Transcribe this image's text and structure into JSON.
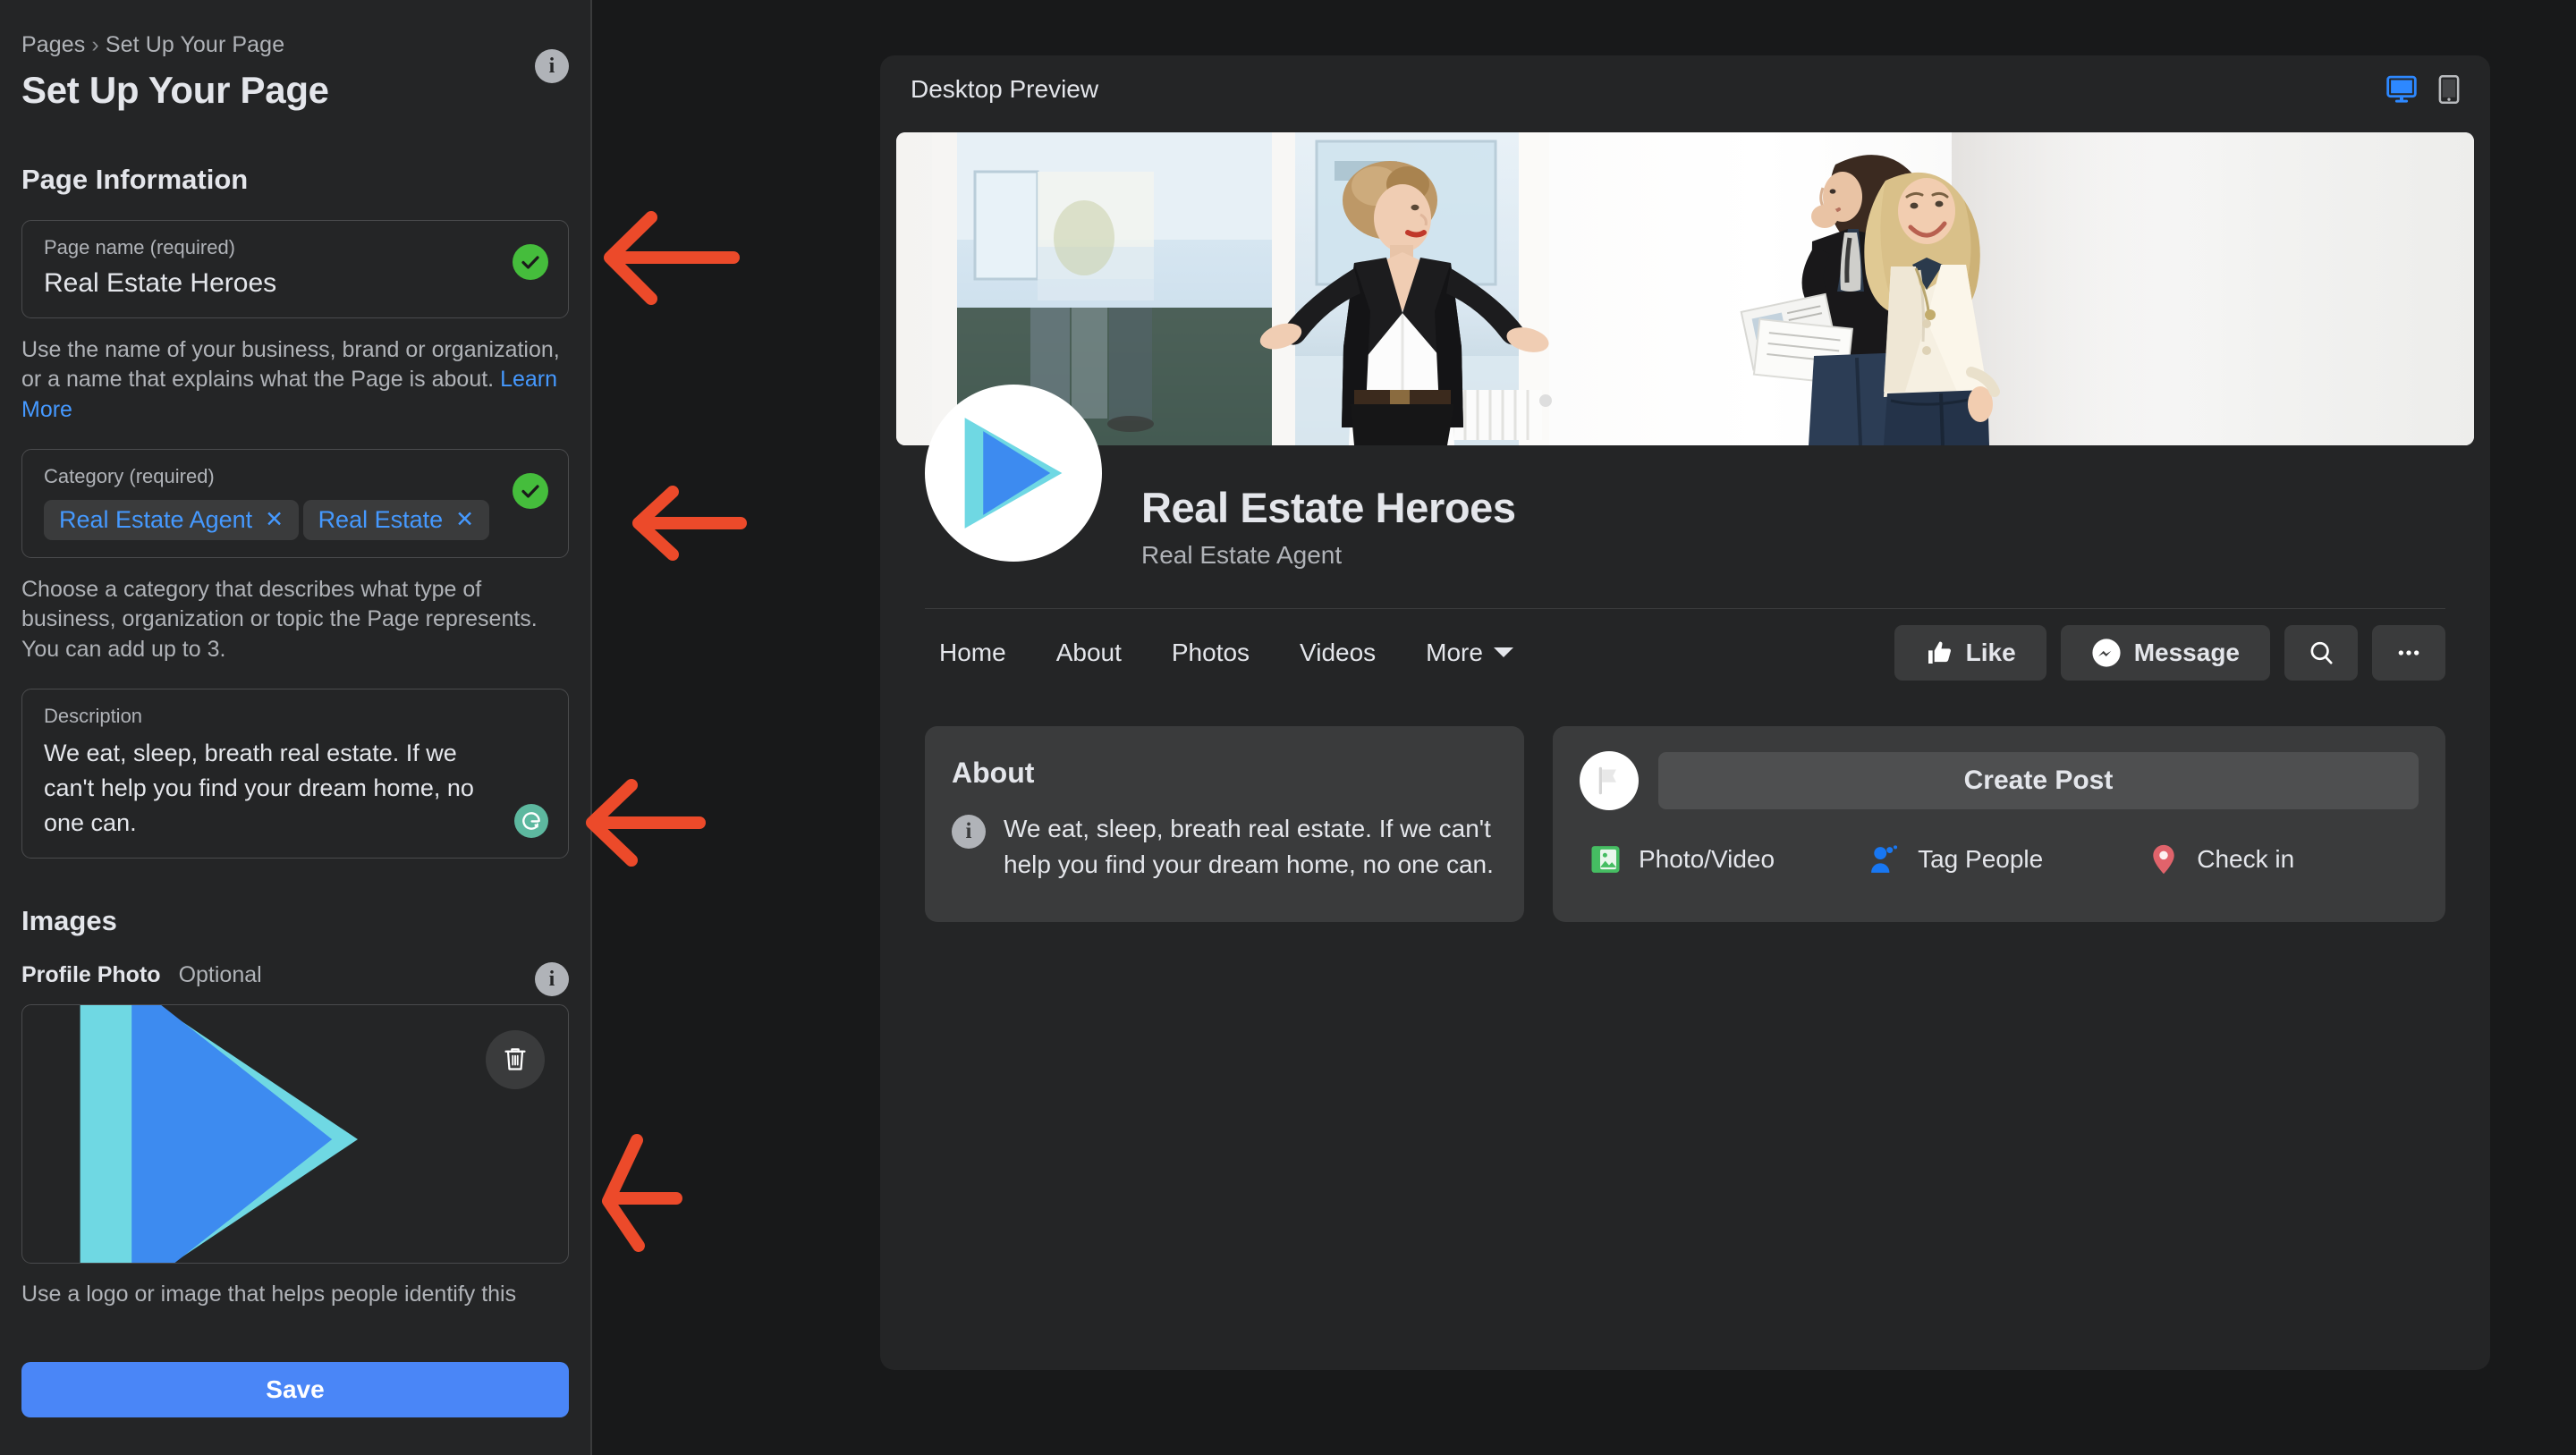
{
  "sidebar": {
    "breadcrumb": {
      "parent": "Pages",
      "separator": "›",
      "current": "Set Up Your Page"
    },
    "title": "Set Up Your Page",
    "info_icon": "i",
    "sections": {
      "page_information": "Page Information",
      "images": "Images"
    },
    "page_name": {
      "label": "Page name (required)",
      "value": "Real Estate Heroes",
      "status": "valid",
      "helper": "Use the name of your business, brand or organization, or a name that explains what the Page is about. ",
      "helper_link": "Learn More"
    },
    "category": {
      "label": "Category (required)",
      "status": "valid",
      "chips": [
        {
          "label": "Real Estate Agent",
          "remove": "✕"
        },
        {
          "label": "Real Estate",
          "remove": "✕"
        }
      ],
      "helper": "Choose a category that describes what type of business, organization or topic the Page represents. You can add up to 3."
    },
    "description": {
      "label": "Description",
      "value": "We eat, sleep, breath real estate. If we can't help you find your dream home, no one can.",
      "grammarly_icon": "grammarly-icon"
    },
    "profile_photo": {
      "label": "Profile Photo",
      "optional": "Optional",
      "info_icon": "i",
      "delete_icon": "trash-icon",
      "helper": "Use a logo or image that helps people identify this"
    },
    "save_label": "Save"
  },
  "preview": {
    "title": "Desktop Preview",
    "devices": [
      {
        "name": "desktop",
        "active": true
      },
      {
        "name": "mobile",
        "active": false
      }
    ],
    "page": {
      "name": "Real Estate Heroes",
      "category": "Real Estate Agent",
      "nav": [
        "Home",
        "About",
        "Photos",
        "Videos"
      ],
      "nav_more": "More",
      "actions": [
        {
          "label": "Like",
          "icon": "thumbs-up-icon"
        },
        {
          "label": "Message",
          "icon": "messenger-icon"
        },
        {
          "label": "",
          "icon": "search-icon"
        },
        {
          "label": "",
          "icon": "ellipsis-icon"
        }
      ],
      "about": {
        "heading": "About",
        "info_icon": "i",
        "text": "We eat, sleep, breath real estate. If we can't help you find your dream home, no one can."
      },
      "composer": {
        "create_post": "Create Post",
        "actions": [
          {
            "label": "Photo/Video",
            "icon": "photo-video-icon",
            "color": "#45bd62"
          },
          {
            "label": "Tag People",
            "icon": "tag-people-icon",
            "color": "#1877f2"
          },
          {
            "label": "Check in",
            "icon": "location-pin-icon",
            "color": "#f5533d"
          }
        ]
      }
    }
  },
  "annotations": {
    "color": "#ec4a2a",
    "arrows": [
      {
        "name": "arrow-to-page-name",
        "target": "page-name-field"
      },
      {
        "name": "arrow-to-category",
        "target": "category-field"
      },
      {
        "name": "arrow-to-description",
        "target": "description-field"
      },
      {
        "name": "arrow-to-profile-photo",
        "target": "profile-photo-field"
      }
    ]
  },
  "colors": {
    "accent_blue": "#4a86f7",
    "link_blue": "#4599ff",
    "success_green": "#45bd3c",
    "panel_bg": "#242526",
    "page_bg": "#18191a",
    "card_bg": "#3a3b3c"
  }
}
